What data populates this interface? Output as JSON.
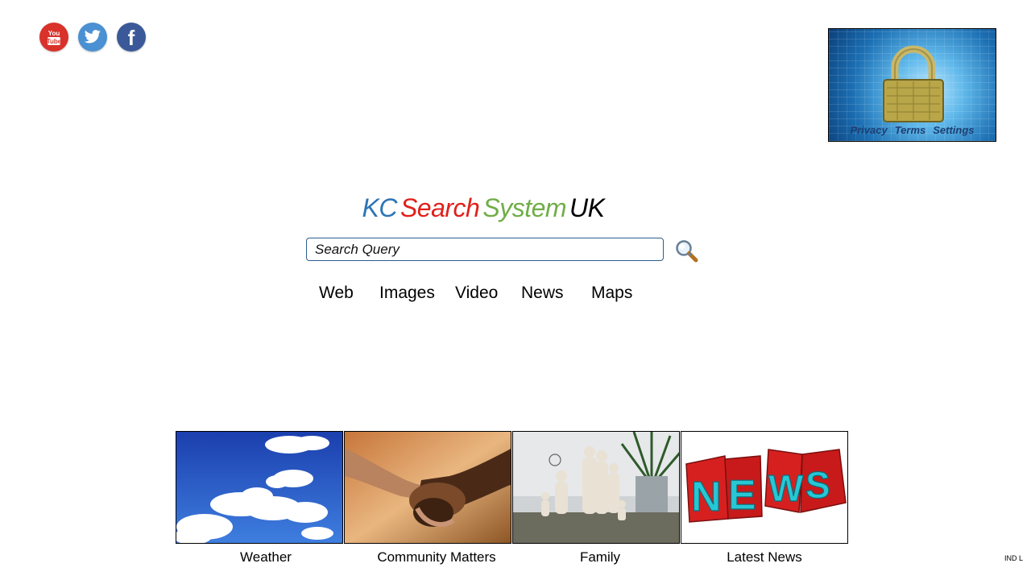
{
  "social": [
    {
      "name": "youtube-icon",
      "text": "You\nTube"
    },
    {
      "name": "twitter-icon"
    },
    {
      "name": "facebook-icon",
      "text": "f"
    }
  ],
  "privacy": {
    "links": [
      "Privacy",
      "Terms",
      "Settings"
    ]
  },
  "logo": {
    "parts": [
      {
        "text": "KC",
        "color": "#2e75b6"
      },
      {
        "text": "Search",
        "color": "#e0201b"
      },
      {
        "text": "System",
        "color": "#70ad47"
      },
      {
        "text": "UK",
        "color": "#000000"
      }
    ]
  },
  "search": {
    "placeholder": "Search Query"
  },
  "nav": [
    "Web",
    "Images",
    "Video",
    "News",
    "Maps"
  ],
  "tiles": [
    {
      "label": "Weather"
    },
    {
      "label": "Community Matters"
    },
    {
      "label": "Family"
    },
    {
      "label": "Latest News"
    }
  ],
  "footer": {
    "corner": "IND L"
  }
}
